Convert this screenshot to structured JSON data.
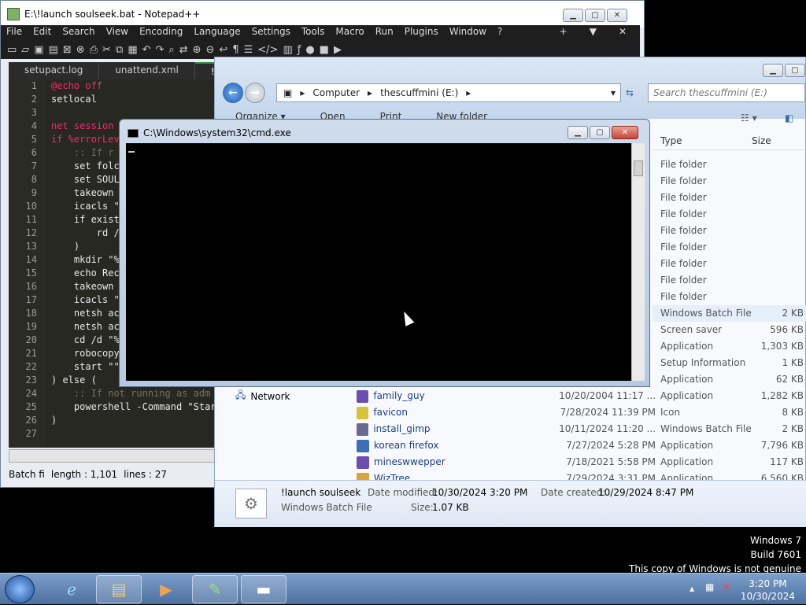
{
  "notepad": {
    "title": "E:\\!launch soulseek.bat - Notepad++",
    "menu": [
      "File",
      "Edit",
      "Search",
      "View",
      "Encoding",
      "Language",
      "Settings",
      "Tools",
      "Macro",
      "Run",
      "Plugins",
      "Window",
      "?"
    ],
    "menu_right": [
      "+",
      "▼",
      "✕"
    ],
    "tabs": [
      "setupact.log",
      "unattend.xml",
      "!lau"
    ],
    "line_numbers": [
      "1",
      "2",
      "3",
      "4",
      "5",
      "6",
      "7",
      "8",
      "9",
      "10",
      "11",
      "12",
      "13",
      "14",
      "15",
      "16",
      "17",
      "18",
      "19",
      "20",
      "21",
      "22",
      "23",
      "24",
      "25",
      "26",
      "27"
    ],
    "code_lines": [
      "@echo off",
      "setlocal",
      "",
      "net session",
      "if %errorLev",
      "    :: If r",
      "    set folc",
      "    set SOUL",
      "    takeown",
      "    icacls \"",
      "    if exist",
      "        rd /",
      "    )",
      "    mkdir \"%",
      "    echo Rec",
      "    takeown",
      "    icacls \"",
      "    netsh ac",
      "    netsh ac",
      "    cd /d \"%",
      "    robocopy",
      "    start \"\"",
      ") else (",
      "    :: If not running as adm",
      "    powershell -Command \"Star",
      ")",
      ""
    ],
    "status": {
      "type": "Batch fi",
      "length": "length : 1,101",
      "lines": "lines : 27"
    }
  },
  "explorer": {
    "breadcrumb": [
      "Computer",
      "thescuffmini (E:)"
    ],
    "search_placeholder": "Search thescuffmini (E:)",
    "commands": [
      "Organize ▾",
      "Open",
      "Print",
      "New folder"
    ],
    "columns": {
      "type": "Type",
      "size": "Size"
    },
    "rows": [
      {
        "type": "File folder",
        "size": ""
      },
      {
        "type": "File folder",
        "size": ""
      },
      {
        "type": "File folder",
        "size": ""
      },
      {
        "type": "File folder",
        "size": ""
      },
      {
        "type": "File folder",
        "size": ""
      },
      {
        "type": "File folder",
        "size": ""
      },
      {
        "type": "File folder",
        "size": ""
      },
      {
        "type": "File folder",
        "size": ""
      },
      {
        "type": "File folder",
        "size": ""
      },
      {
        "type": "Windows Batch File",
        "size": "2 KB"
      },
      {
        "type": "Screen saver",
        "size": "596 KB"
      },
      {
        "type": "Application",
        "size": "1,303 KB"
      },
      {
        "type": "Setup Information",
        "size": "1 KB"
      },
      {
        "type": "Application",
        "size": "62 KB"
      },
      {
        "type": "Application",
        "size": "1,282 KB"
      },
      {
        "type": "Icon",
        "size": "8 KB"
      },
      {
        "type": "Windows Batch File",
        "size": "2 KB"
      },
      {
        "type": "Application",
        "size": "7,796 KB"
      },
      {
        "type": "Application",
        "size": "117 KB"
      },
      {
        "type": "Application",
        "size": "6,560 KB"
      }
    ],
    "network_label": "Network",
    "files": [
      {
        "name": "family_guy",
        "date": "10/20/2004 11:17 ..."
      },
      {
        "name": "favicon",
        "date": "7/28/2024 11:39 PM"
      },
      {
        "name": "install_gimp",
        "date": "10/11/2024 11:20 ..."
      },
      {
        "name": "korean firefox",
        "date": "7/27/2024 5:28 PM"
      },
      {
        "name": "mineswwepper",
        "date": "7/18/2021 5:58 PM"
      },
      {
        "name": "WizTree",
        "date": "7/29/2024 3:31 PM"
      }
    ],
    "details": {
      "name": "!launch soulseek",
      "type": "Windows Batch File",
      "modified_label": "Date modified:",
      "modified": "10/30/2024 3:20 PM",
      "created_label": "Date created:",
      "created": "10/29/2024 8:47 PM",
      "size_label": "Size:",
      "size": "1.07 KB"
    }
  },
  "cmd": {
    "title": "C:\\Windows\\system32\\cmd.exe"
  },
  "watermark": {
    "line1": "Windows 7",
    "line2": "Build 7601",
    "line3": "This copy of Windows is not genuine"
  },
  "taskbar": {
    "time": "3:20 PM",
    "date": "10/30/2024"
  }
}
